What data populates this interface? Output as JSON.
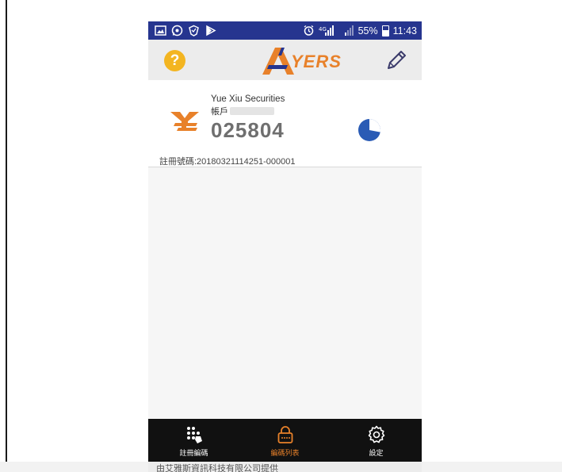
{
  "status_bar": {
    "left_icons": [
      "image-icon",
      "whatsapp-icon",
      "shield-icon",
      "play-store-icon"
    ],
    "right_icons": [
      "alarm-icon",
      "network-icon",
      "signal-icon",
      "signal-weak-icon",
      "battery-icon"
    ],
    "battery": "55%",
    "time": "11:43"
  },
  "header": {
    "help_label": "?",
    "logo_text": "YERS",
    "logo_icon": "ayers-logo-icon",
    "edit_icon": "pencil-icon"
  },
  "account": {
    "company": "Yue Xiu Securities",
    "account_label": "帳戶",
    "otp_code": "025804",
    "registration": "註冊號碼:20180321114251-000001",
    "timer_fraction_remaining": 0.72
  },
  "nav": {
    "items": [
      {
        "label": "註冊編碼",
        "icon": "keypad-icon",
        "active": false
      },
      {
        "label": "編碼列表",
        "icon": "lock-icon",
        "active": true
      },
      {
        "label": "設定",
        "icon": "gear-icon",
        "active": false
      }
    ]
  },
  "footer": {
    "text": "由艾雅斯資訊科技有限公司提供"
  },
  "colors": {
    "status_bar": "#26358f",
    "accent": "#e8812a",
    "help": "#f3b521",
    "timer": "#2a5bb5",
    "nav_bg": "#111111"
  }
}
